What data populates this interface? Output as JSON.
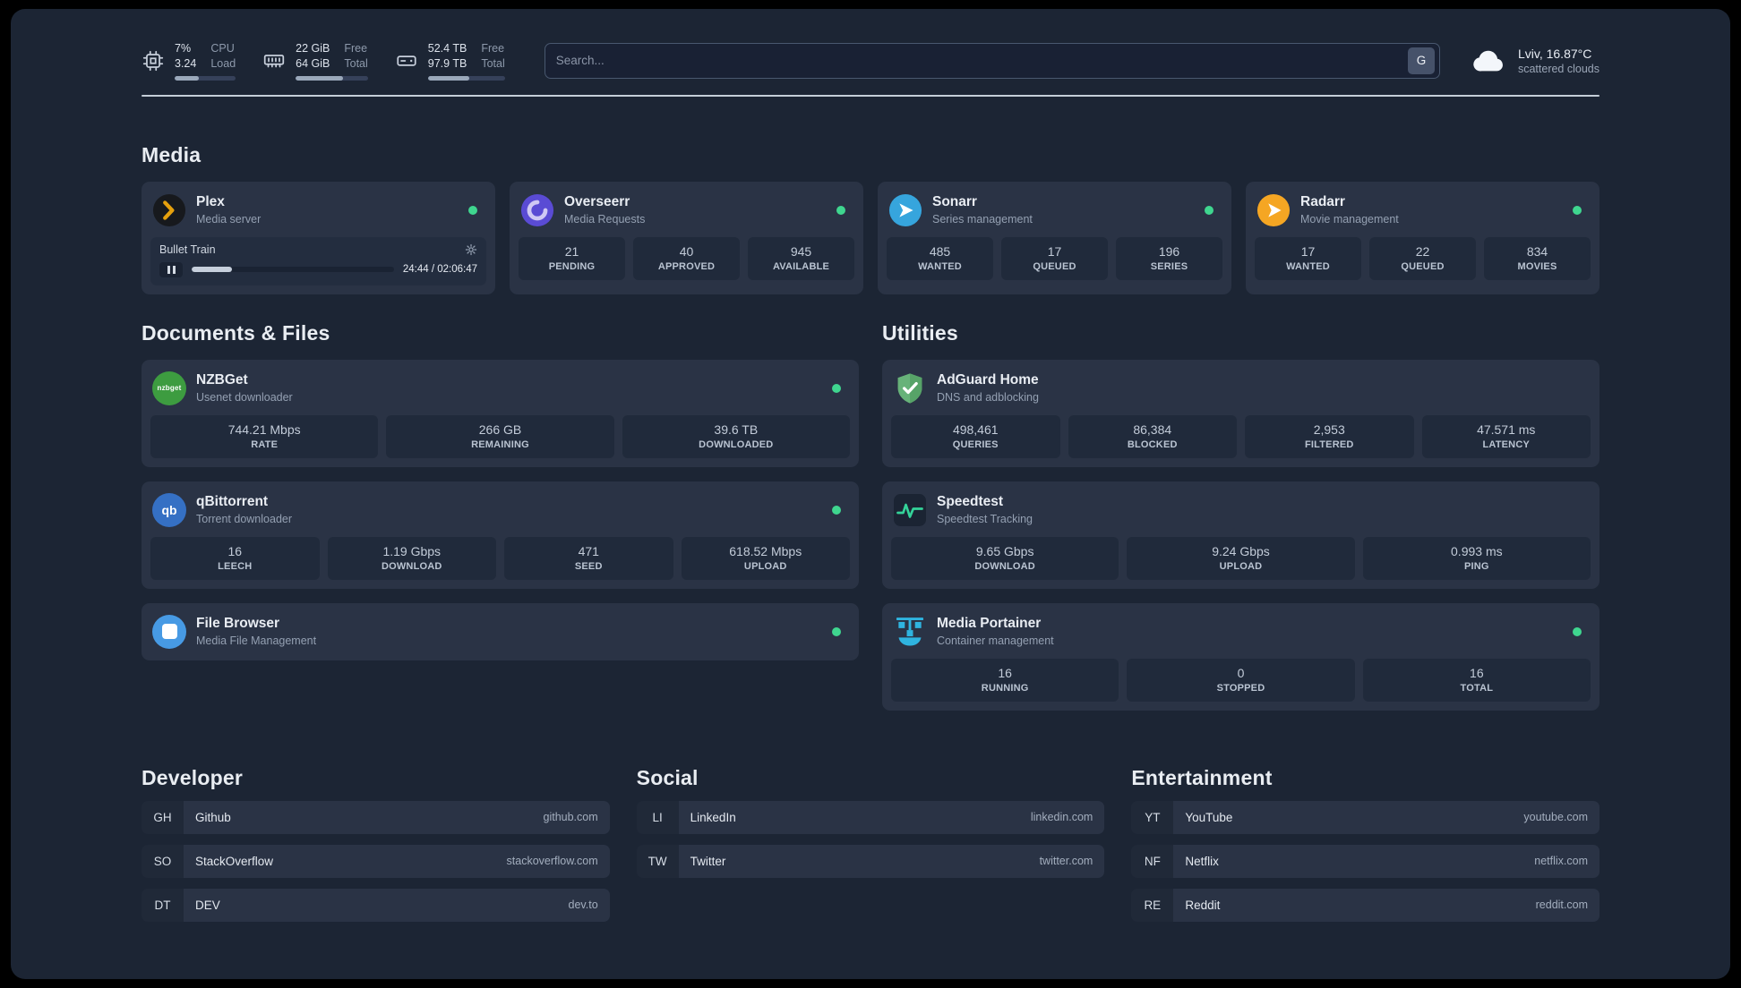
{
  "colors": {
    "background": "#1c2534",
    "card": "#2a3345",
    "tile": "#202a3b",
    "status_online": "#3fd68f",
    "plex_accent": "#e5a00d",
    "adguard_green": "#67b279",
    "portainer_blue": "#2fb4e0"
  },
  "topbar": {
    "cpu": {
      "value1": "7%",
      "value2": "3.24",
      "label1": "CPU",
      "label2": "Load",
      "bar_percent": 40
    },
    "ram": {
      "value1": "22 GiB",
      "value2": "64 GiB",
      "label1": "Free",
      "label2": "Total",
      "bar_percent": 65
    },
    "disk": {
      "value1": "52.4 TB",
      "value2": "97.9 TB",
      "label1": "Free",
      "label2": "Total",
      "bar_percent": 54
    },
    "search": {
      "placeholder": "Search...",
      "button_label": "G"
    },
    "weather": {
      "location": "Lviv, 16.87°C",
      "condition": "scattered clouds"
    }
  },
  "sections": {
    "media": {
      "title": "Media",
      "plex": {
        "name": "Plex",
        "desc": "Media server",
        "now_playing": "Bullet Train",
        "time": "24:44 / 02:06:47",
        "progress_percent": 20
      },
      "overseerr": {
        "name": "Overseerr",
        "desc": "Media Requests",
        "stats": [
          {
            "value": "21",
            "label": "PENDING"
          },
          {
            "value": "40",
            "label": "APPROVED"
          },
          {
            "value": "945",
            "label": "AVAILABLE"
          }
        ]
      },
      "sonarr": {
        "name": "Sonarr",
        "desc": "Series management",
        "stats": [
          {
            "value": "485",
            "label": "WANTED"
          },
          {
            "value": "17",
            "label": "QUEUED"
          },
          {
            "value": "196",
            "label": "SERIES"
          }
        ]
      },
      "radarr": {
        "name": "Radarr",
        "desc": "Movie management",
        "stats": [
          {
            "value": "17",
            "label": "WANTED"
          },
          {
            "value": "22",
            "label": "QUEUED"
          },
          {
            "value": "834",
            "label": "MOVIES"
          }
        ]
      }
    },
    "documents": {
      "title": "Documents & Files",
      "nzbget": {
        "name": "NZBGet",
        "desc": "Usenet downloader",
        "icon_text": "nzbget",
        "stats": [
          {
            "value": "744.21 Mbps",
            "label": "RATE"
          },
          {
            "value": "266 GB",
            "label": "REMAINING"
          },
          {
            "value": "39.6 TB",
            "label": "DOWNLOADED"
          }
        ]
      },
      "qbittorrent": {
        "name": "qBittorrent",
        "desc": "Torrent downloader",
        "icon_text": "qb",
        "stats": [
          {
            "value": "16",
            "label": "LEECH"
          },
          {
            "value": "1.19 Gbps",
            "label": "DOWNLOAD"
          },
          {
            "value": "471",
            "label": "SEED"
          },
          {
            "value": "618.52 Mbps",
            "label": "UPLOAD"
          }
        ]
      },
      "filebrowser": {
        "name": "File Browser",
        "desc": "Media File Management"
      }
    },
    "utilities": {
      "title": "Utilities",
      "adguard": {
        "name": "AdGuard Home",
        "desc": "DNS and adblocking",
        "stats": [
          {
            "value": "498,461",
            "label": "QUERIES"
          },
          {
            "value": "86,384",
            "label": "BLOCKED"
          },
          {
            "value": "2,953",
            "label": "FILTERED"
          },
          {
            "value": "47.571 ms",
            "label": "LATENCY"
          }
        ]
      },
      "speedtest": {
        "name": "Speedtest",
        "desc": "Speedtest Tracking",
        "stats": [
          {
            "value": "9.65 Gbps",
            "label": "DOWNLOAD"
          },
          {
            "value": "9.24 Gbps",
            "label": "UPLOAD"
          },
          {
            "value": "0.993 ms",
            "label": "PING"
          }
        ]
      },
      "portainer": {
        "name": "Media Portainer",
        "desc": "Container management",
        "stats": [
          {
            "value": "16",
            "label": "RUNNING"
          },
          {
            "value": "0",
            "label": "STOPPED"
          },
          {
            "value": "16",
            "label": "TOTAL"
          }
        ]
      }
    },
    "bookmarks": {
      "developer": {
        "title": "Developer",
        "items": [
          {
            "abbr": "GH",
            "name": "Github",
            "url": "github.com"
          },
          {
            "abbr": "SO",
            "name": "StackOverflow",
            "url": "stackoverflow.com"
          },
          {
            "abbr": "DT",
            "name": "DEV",
            "url": "dev.to"
          }
        ]
      },
      "social": {
        "title": "Social",
        "items": [
          {
            "abbr": "LI",
            "name": "LinkedIn",
            "url": "linkedin.com"
          },
          {
            "abbr": "TW",
            "name": "Twitter",
            "url": "twitter.com"
          }
        ]
      },
      "entertainment": {
        "title": "Entertainment",
        "items": [
          {
            "abbr": "YT",
            "name": "YouTube",
            "url": "youtube.com"
          },
          {
            "abbr": "NF",
            "name": "Netflix",
            "url": "netflix.com"
          },
          {
            "abbr": "RE",
            "name": "Reddit",
            "url": "reddit.com"
          }
        ]
      }
    }
  }
}
